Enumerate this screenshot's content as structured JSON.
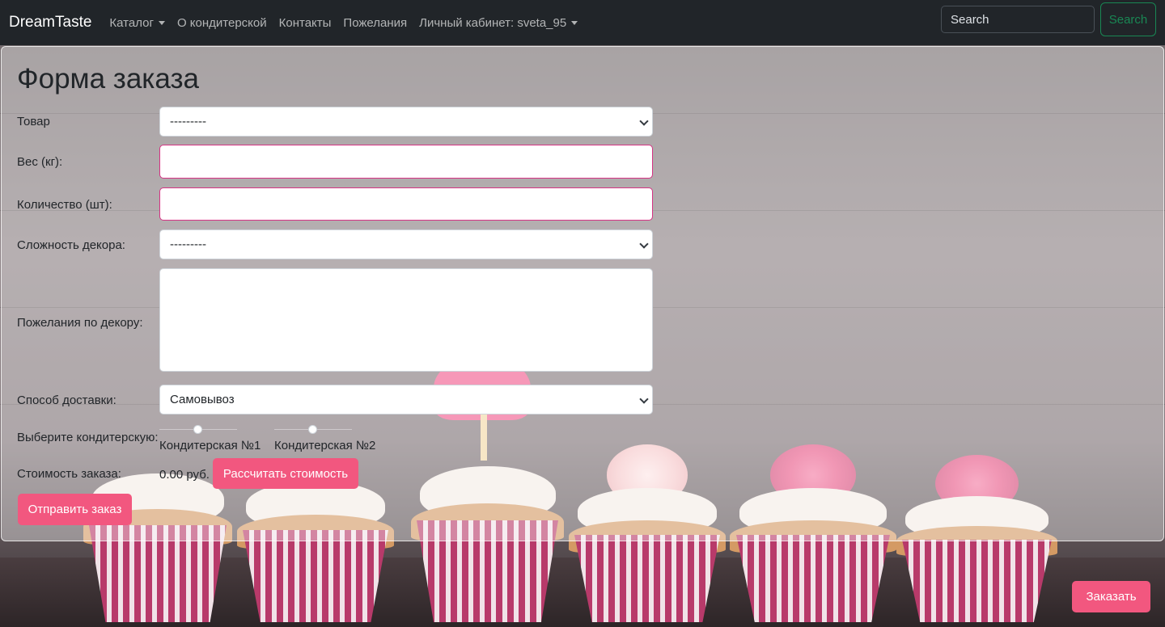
{
  "navbar": {
    "brand": "DreamTaste",
    "links": [
      {
        "label": "Каталог",
        "dropdown": true
      },
      {
        "label": "О кондитерской",
        "dropdown": false
      },
      {
        "label": "Контакты",
        "dropdown": false
      },
      {
        "label": "Пожелания",
        "dropdown": false
      },
      {
        "label": "Личный кабинет: sveta_95",
        "dropdown": true
      }
    ],
    "search_placeholder": "Search",
    "search_button": "Search"
  },
  "form": {
    "title": "Форма заказа",
    "product_label": "Товар",
    "product_value": "---------",
    "weight_label": "Вес (кг):",
    "weight_value": "",
    "quantity_label": "Количество (шт):",
    "quantity_value": "",
    "decor_complexity_label": "Сложность декора:",
    "decor_complexity_value": "---------",
    "decor_wishes_label": "Пожелания по декору:",
    "decor_wishes_value": "",
    "delivery_label": "Способ доставки:",
    "delivery_value": "Самовывоз",
    "bakery_label": "Выберите кондитерскую:",
    "bakery_options": [
      "Кондитерская №1",
      "Кондитерская №2"
    ],
    "cost_label": "Стоимость заказа:",
    "cost_value": "0.00 руб.",
    "calculate_button": "Рассчитать стоимость",
    "submit_button": "Отправить заказ"
  },
  "order_button": "Заказать",
  "colors": {
    "navbar_bg": "#212529",
    "accent_pink": "#f2577f",
    "search_green": "#198754",
    "invalid_border": "#d63384"
  }
}
